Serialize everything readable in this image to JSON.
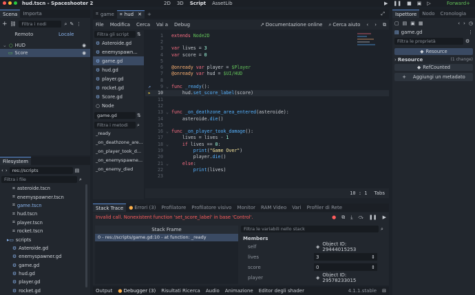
{
  "window": {
    "title": "hud.tscn - Spaceshooter 2"
  },
  "top_menu": {
    "btn_2d": "2D",
    "btn_3d": "3D",
    "btn_script": "Script",
    "btn_assetlib": "AssetLib",
    "renderer": "Forward+"
  },
  "scene_dock": {
    "tabs": [
      "Scena",
      "Importa"
    ],
    "filter_placeholder": "Filtra i nodi",
    "remote": "Remoto",
    "local": "Locale",
    "nodes": [
      {
        "name": "HUD"
      },
      {
        "name": "Score"
      }
    ]
  },
  "filesystem": {
    "title": "Filesystem",
    "path": "res://scripts",
    "filter_placeholder": "Filtra i file",
    "items": [
      "asteroide.tscn",
      "enemyspawner.tscn",
      "game.tscn",
      "hud.tscn",
      "player.tscn",
      "rocket.tscn",
      "scripts",
      "Asteroide.gd",
      "enemyspawner.gd",
      "game.gd",
      "hud.gd",
      "player.gd",
      "rocket.gd"
    ]
  },
  "editor_tabs": {
    "tab1": "game",
    "tab2": "hud"
  },
  "script_menu": {
    "file": "File",
    "edit": "Modifica",
    "search": "Cerca",
    "goto": "Vai a",
    "debug": "Debug",
    "online_docs": "Documentazione online",
    "search_help": "Cerca aiuto"
  },
  "script_list": {
    "filter_placeholder": "Filtra gli script",
    "items": [
      "Asteroide.gd",
      "enemyspawn...",
      "game.gd",
      "hud.gd",
      "player.gd",
      "rocket.gd",
      "Score.gd",
      "Node"
    ],
    "current": "game.gd",
    "methods_placeholder": "Filtra i metodi",
    "methods": [
      "_ready",
      "_on_deathzone_are...",
      "_on_player_took_d...",
      "_on_enemyspawne...",
      "_on_enemy_died"
    ]
  },
  "code": {
    "lines": [
      {
        "n": "1",
        "t": "extends Node2D"
      },
      {
        "n": "2",
        "t": ""
      },
      {
        "n": "3",
        "t": "var lives = 3"
      },
      {
        "n": "4",
        "t": "var score = 0"
      },
      {
        "n": "5",
        "t": ""
      },
      {
        "n": "6",
        "t": "@onready var player = $Player"
      },
      {
        "n": "7",
        "t": "@onready var hud = $UI/HUD"
      },
      {
        "n": "8",
        "t": ""
      },
      {
        "n": "9",
        "t": "func _ready():"
      },
      {
        "n": "10",
        "t": "    hud.set_score_label(score)"
      },
      {
        "n": "11",
        "t": ""
      },
      {
        "n": "12",
        "t": ""
      },
      {
        "n": "13",
        "t": "func _on_deathzone_area_entered(asteroide):"
      },
      {
        "n": "14",
        "t": "    asteroide.die()"
      },
      {
        "n": "15",
        "t": ""
      },
      {
        "n": "16",
        "t": "func _on_player_took_damage():"
      },
      {
        "n": "17",
        "t": "    lives = lives - 1"
      },
      {
        "n": "18",
        "t": "    if lives == 0:"
      },
      {
        "n": "19",
        "t": "        print(\"Game Over\")"
      },
      {
        "n": "20",
        "t": "        player.die()"
      },
      {
        "n": "21",
        "t": "    else:"
      },
      {
        "n": "22",
        "t": "        print(lives)"
      },
      {
        "n": "23",
        "t": ""
      }
    ],
    "cursor": "10  :    1",
    "tabs_label": "Tabs"
  },
  "debugger": {
    "tabs": [
      "Stack Trace",
      "Errori (3)",
      "Profilatore",
      "Profilatore visivo",
      "Monitor",
      "RAM Video",
      "Vari",
      "Profiler di Rete"
    ],
    "error": "Invalid call. Nonexistent function 'set_score_label' in base 'Control'.",
    "stack_header": "Stack Frame",
    "stack_item": "0 - res://scripts/game.gd:10 - at function: _ready",
    "filter_placeholder": "Filtra le variabili nello stack",
    "members_label": "Members",
    "vars": [
      {
        "name": "self",
        "value": "Object ID: 29444015253"
      },
      {
        "name": "lives",
        "value": "3"
      },
      {
        "name": "score",
        "value": "0"
      },
      {
        "name": "player",
        "value": "Object ID: 29578233015"
      }
    ]
  },
  "bottom_bar": {
    "items": [
      "Output",
      "Debugger (3)",
      "Risultati Ricerca",
      "Audio",
      "Animazione",
      "Editor degli shader"
    ],
    "version": "4.1.1.stable"
  },
  "inspector": {
    "tabs": [
      "Ispettore",
      "Nodo",
      "Cronologia"
    ],
    "file": "game.gd",
    "filter_placeholder": "Filtra le proprietà",
    "resource_header": "Resource",
    "resource_row": "Resource",
    "changes": "(1 change)",
    "refcounted": "RefCounted",
    "add_meta": "Aggiungi un metadato"
  },
  "colors": {
    "accent": "#5b8dd6",
    "error": "#ff5d5d",
    "panel": "#22272e"
  }
}
